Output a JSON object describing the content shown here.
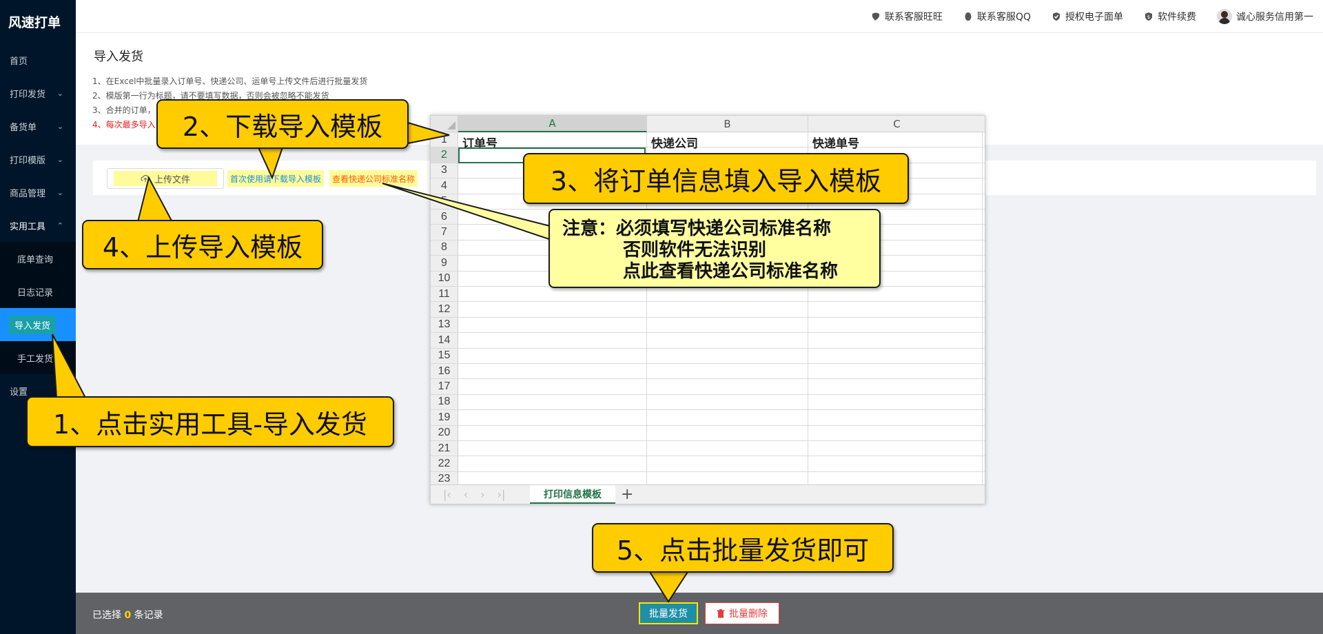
{
  "app": {
    "title": "风速打单"
  },
  "sidebar": {
    "items": [
      {
        "label": "首页",
        "chevron": ""
      },
      {
        "label": "打印发货",
        "chevron": "⌄"
      },
      {
        "label": "备货单",
        "chevron": "⌄"
      },
      {
        "label": "打印模版",
        "chevron": "⌄"
      },
      {
        "label": "商品管理",
        "chevron": "⌄"
      },
      {
        "label": "实用工具",
        "chevron": "⌃"
      }
    ],
    "subitems": [
      {
        "label": "底单查询"
      },
      {
        "label": "日志记录"
      },
      {
        "label": "导入发货"
      },
      {
        "label": "手工发货"
      }
    ],
    "settings": "设置"
  },
  "header": {
    "links": [
      {
        "label": "联系客服旺旺",
        "icon": "wangwang-icon"
      },
      {
        "label": "联系客服QQ",
        "icon": "qq-icon"
      },
      {
        "label": "授权电子面单",
        "icon": "shield-check-icon"
      },
      {
        "label": "软件续费",
        "icon": "shield-dollar-icon"
      }
    ],
    "user": "诚心服务信用第一"
  },
  "page": {
    "title": "导入发货",
    "notes": [
      "1、在Excel中批量录入订单号、快递公司、运单号上传文件后进行批量发货",
      "2、模版第一行为标题，请不要填写数据，否则会被忽略不能发货",
      "3、合并的订单，",
      "4、每次最多导入"
    ]
  },
  "upload": {
    "button": "上传文件",
    "download_link": "首次使用请下载导入模板",
    "standard_link": "查看快递公司标准名称"
  },
  "footer": {
    "selected_prefix": "已选择",
    "selected_count": "0",
    "selected_suffix": "条记录",
    "batch_send": "批量发货",
    "batch_delete": "批量删除"
  },
  "sheet": {
    "columns": [
      "A",
      "B",
      "C"
    ],
    "headers": [
      "订单号",
      "快递公司",
      "快递单号"
    ],
    "rows": [
      "1",
      "2",
      "3",
      "4",
      "5",
      "6",
      "7",
      "8",
      "9",
      "10",
      "11",
      "12",
      "13",
      "14",
      "15",
      "16",
      "17",
      "18",
      "19",
      "20",
      "21",
      "22",
      "23"
    ],
    "tab": "打印信息模板",
    "add_tab": "+",
    "nav": [
      "|‹",
      "‹",
      "›",
      "›|"
    ]
  },
  "callouts": {
    "step1": "1、点击实用工具-导入发货",
    "step2": "2、下载导入模板",
    "step3": "3、将订单信息填入导入模板",
    "step4": "4、上传导入模板",
    "step5": "5、点击批量发货即可",
    "note": [
      "注意：必须填写快递公司标准名称",
      "否则软件无法识别",
      "点此查看快递公司标准名称"
    ]
  },
  "colors": {
    "sidebar": "#001529",
    "active": "#1890ff",
    "callout": "#ffcc00",
    "note": "#ffffa0",
    "excel_green": "#217346"
  }
}
